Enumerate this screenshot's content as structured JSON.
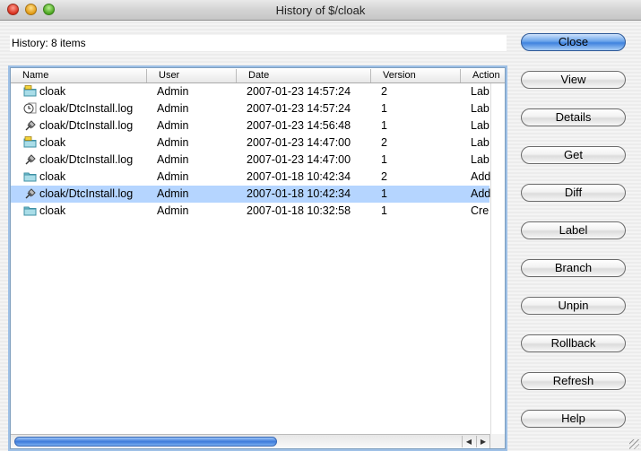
{
  "window": {
    "title": "History of $/cloak"
  },
  "history": {
    "count_label": "History: 8 items"
  },
  "table": {
    "columns": [
      "Name",
      "User",
      "Date",
      "Version",
      "Action"
    ],
    "rows": [
      {
        "icon": "folder-label-icon",
        "name": "cloak",
        "user": "Admin",
        "date": "2007-01-23 14:57:24",
        "version": "2",
        "action": "Lab"
      },
      {
        "icon": "file-clock-icon",
        "name": "cloak/DtcInstall.log",
        "user": "Admin",
        "date": "2007-01-23 14:57:24",
        "version": "1",
        "action": "Lab"
      },
      {
        "icon": "file-pin-icon",
        "name": "cloak/DtcInstall.log",
        "user": "Admin",
        "date": "2007-01-23 14:56:48",
        "version": "1",
        "action": "Lab"
      },
      {
        "icon": "folder-label-icon",
        "name": "cloak",
        "user": "Admin",
        "date": "2007-01-23 14:47:00",
        "version": "2",
        "action": "Lab"
      },
      {
        "icon": "file-pin-icon",
        "name": "cloak/DtcInstall.log",
        "user": "Admin",
        "date": "2007-01-23 14:47:00",
        "version": "1",
        "action": "Lab"
      },
      {
        "icon": "folder-icon",
        "name": "cloak",
        "user": "Admin",
        "date": "2007-01-18 10:42:34",
        "version": "2",
        "action": "Add"
      },
      {
        "icon": "file-pin-icon",
        "name": "cloak/DtcInstall.log",
        "user": "Admin",
        "date": "2007-01-18 10:42:34",
        "version": "1",
        "action": "Add",
        "selected": true
      },
      {
        "icon": "folder-icon",
        "name": "cloak",
        "user": "Admin",
        "date": "2007-01-18 10:32:58",
        "version": "1",
        "action": "Cre"
      }
    ]
  },
  "buttons": {
    "close": "Close",
    "view": "View",
    "details": "Details",
    "get": "Get",
    "diff": "Diff",
    "label": "Label",
    "branch": "Branch",
    "unpin": "Unpin",
    "rollback": "Rollback",
    "refresh": "Refresh",
    "help": "Help"
  },
  "colors": {
    "selection": "#b5d5ff",
    "primary_button": "#3f82de",
    "scroll_thumb": "#3d7bdb"
  }
}
